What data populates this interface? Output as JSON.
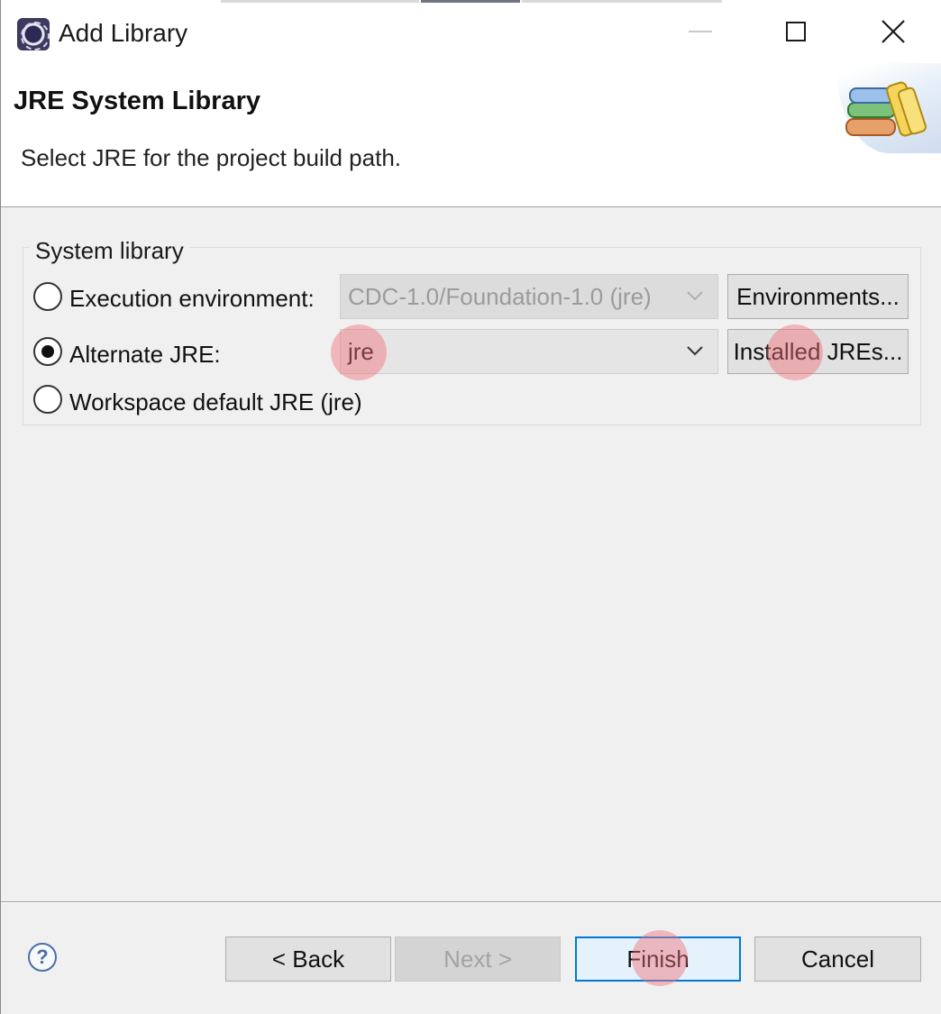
{
  "window": {
    "title": "Add Library",
    "min_icon": "minimize-icon",
    "max_icon": "maximize-icon",
    "close_icon": "close-icon"
  },
  "header": {
    "title": "JRE System Library",
    "description": "Select JRE for the project build path.",
    "banner_icon": "library-books-icon"
  },
  "system_library": {
    "legend": "System library",
    "options": [
      {
        "label": "Execution environment:",
        "selected": false,
        "combo_value": "CDC-1.0/Foundation-1.0 (jre)",
        "combo_enabled": false,
        "button_label": "Environments..."
      },
      {
        "label": "Alternate JRE:",
        "selected": true,
        "combo_value": "jre",
        "combo_enabled": true,
        "button_label": "Installed JREs..."
      },
      {
        "label": "Workspace default JRE (jre)",
        "selected": false
      }
    ]
  },
  "footer": {
    "help_icon": "help-icon",
    "help_glyph": "?",
    "back_label": "< Back",
    "next_label": "Next >",
    "finish_label": "Finish",
    "cancel_label": "Cancel"
  },
  "colors": {
    "default_button_border": "#0078d7",
    "click_marker": "#f06e78"
  }
}
